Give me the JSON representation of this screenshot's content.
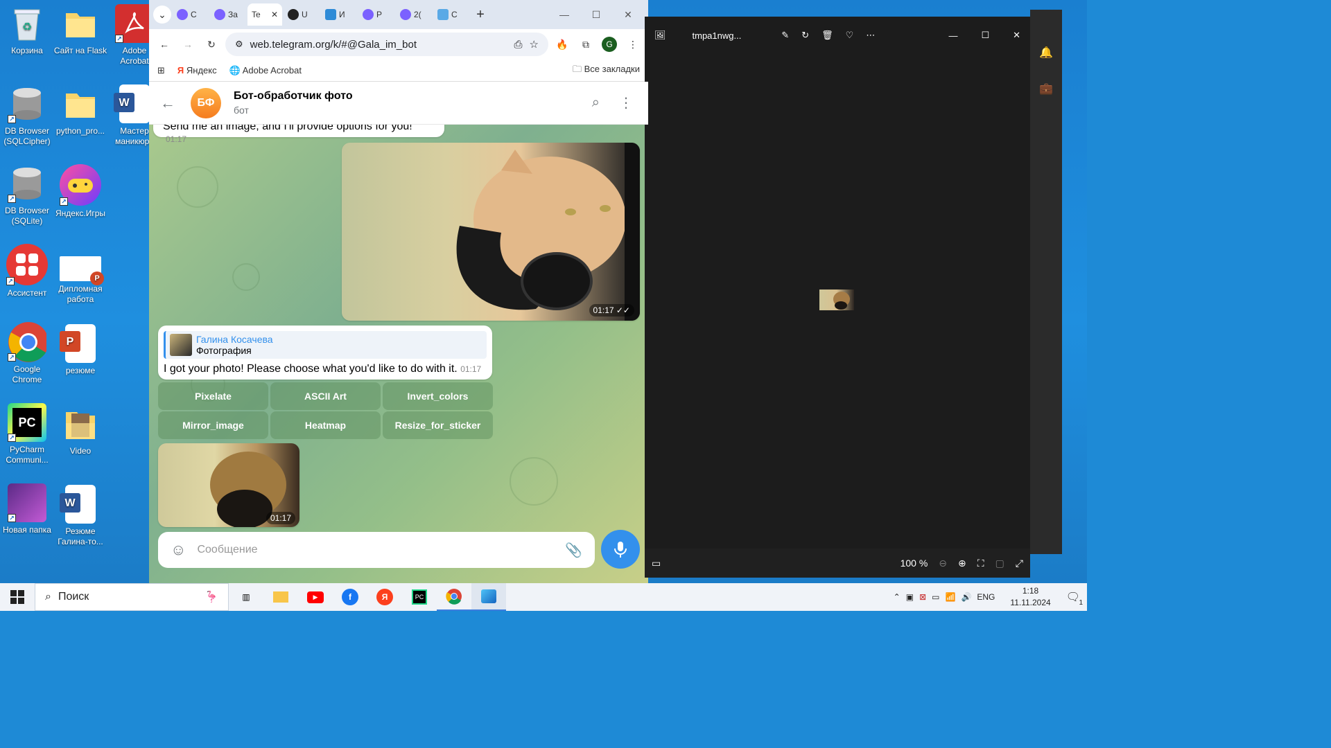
{
  "desktop": {
    "icons": [
      {
        "label": "Корзина",
        "icon": "recycle-bin-icon"
      },
      {
        "label": "Сайт на Flask",
        "icon": "folder-icon"
      },
      {
        "label": "Adobe Acrobat",
        "icon": "acrobat-icon"
      },
      {
        "label": "DB Browser (SQLCipher)",
        "icon": "database-icon"
      },
      {
        "label": "python_pro...",
        "icon": "folder-icon"
      },
      {
        "label": "Мастер маникюра",
        "icon": "word-icon"
      },
      {
        "label": "DB Browser (SQLite)",
        "icon": "database-icon"
      },
      {
        "label": "Яндекс.Игры",
        "icon": "gamepad-icon"
      },
      {
        "label": "Ассистент",
        "icon": "assistant-icon"
      },
      {
        "label": "Дипломная работа",
        "icon": "powerpoint-icon"
      },
      {
        "label": "Google Chrome",
        "icon": "chrome-icon"
      },
      {
        "label": "резюме",
        "icon": "powerpoint-icon"
      },
      {
        "label": "PyCharm Communi...",
        "icon": "pycharm-icon"
      },
      {
        "label": "Video",
        "icon": "folder-icon"
      },
      {
        "label": "Новая папка",
        "icon": "folder-icon"
      },
      {
        "label": "Резюме Галина-то...",
        "icon": "word-icon"
      }
    ]
  },
  "browser": {
    "tabs": [
      {
        "label": "С",
        "icon": "tab-icon"
      },
      {
        "label": "За",
        "icon": "tab-icon"
      },
      {
        "label": "Te",
        "icon": "telegram-icon",
        "active": true
      },
      {
        "label": "U",
        "icon": "github-icon"
      },
      {
        "label": "И",
        "icon": "fix-icon"
      },
      {
        "label": "Р",
        "icon": "tab-icon"
      },
      {
        "label": "2(",
        "icon": "tab-icon"
      },
      {
        "label": "С",
        "icon": "tab-icon"
      }
    ],
    "url": "web.telegram.org/k/#@Gala_im_bot",
    "profile_letter": "G",
    "bookmarks": [
      {
        "label": "Яндекс"
      },
      {
        "label": "Adobe Acrobat"
      }
    ],
    "all_bookmarks": "Все закладки"
  },
  "telegram": {
    "avatar_initials": "БФ",
    "chat_title": "Бот-обработчик фото",
    "chat_subtitle": "бот",
    "messages": {
      "top_text": "Send me an image, and I'll provide options for you!",
      "top_time": "01:17",
      "photo_time": "01:17",
      "reply_author": "Галина Косачева",
      "reply_preview": "Фотография",
      "reply_text": "I got your photo! Please choose what you'd like to do with it.",
      "reply_time": "01:17",
      "result_time": "01:17"
    },
    "keyboard": [
      "Pixelate",
      "ASCII Art",
      "Invert_colors",
      "Mirror_image",
      "Heatmap",
      "Resize_for_sticker"
    ],
    "input_placeholder": "Сообщение"
  },
  "photos": {
    "filename": "tmpa1nwg...",
    "zoom": "100 %"
  },
  "taskbar": {
    "search_label": "Поиск",
    "lang": "ENG",
    "time": "1:18",
    "date": "11.11.2024",
    "notifications": "1"
  }
}
